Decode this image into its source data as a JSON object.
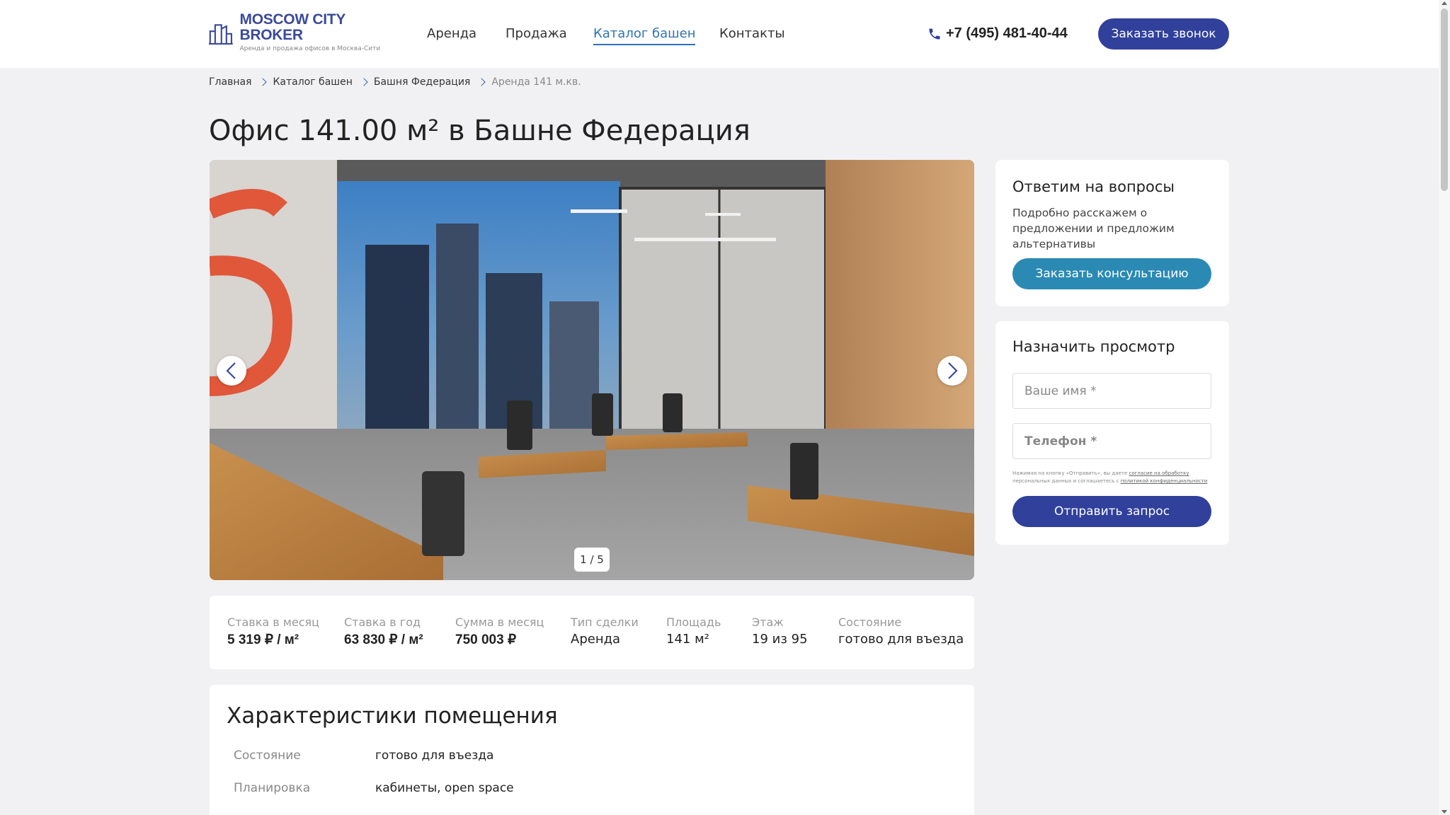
{
  "logo": {
    "title": "MOSCOW CITY BROKER",
    "subtitle": "Аренда и продажа офисов в Москва-Сити",
    "icon": "city-towers-logo"
  },
  "nav": {
    "items": [
      {
        "label": "Аренда",
        "active": false
      },
      {
        "label": "Продажа",
        "active": false
      },
      {
        "label": "Каталог башен",
        "active": true
      },
      {
        "label": "Контакты",
        "active": false
      }
    ]
  },
  "header": {
    "phone": "+7 (495) 481-40-44",
    "phone_icon": "phone-icon",
    "call_button": "Заказать звонок"
  },
  "breadcrumb": {
    "items": [
      "Главная",
      "Каталог башен",
      "Башня Федерация"
    ],
    "current": "Аренда 141 м.кв."
  },
  "page": {
    "title": "Офис 141.00 м² в Башне Федерация"
  },
  "gallery": {
    "counter": "1 / 5",
    "prev_icon": "chevron-left-icon",
    "next_icon": "chevron-right-icon"
  },
  "stats": [
    {
      "label": "Ставка в месяц",
      "value": "5 319 ₽ / м²",
      "bold": true
    },
    {
      "label": "Ставка в год",
      "value": "63 830 ₽ / м²",
      "bold": true
    },
    {
      "label": "Сумма в месяц",
      "value": "750 003 ₽",
      "bold": true
    },
    {
      "label": "Тип сделки",
      "value": "Аренда",
      "bold": false
    },
    {
      "label": "Площадь",
      "value": "141 м²",
      "bold": false
    },
    {
      "label": "Этаж",
      "value": "19 из 95",
      "bold": false
    },
    {
      "label": "Состояние",
      "value": "готово для въезда",
      "bold": false
    }
  ],
  "characteristics": {
    "title": "Характеристики помещения",
    "rows": [
      {
        "key": "Состояние",
        "value": "готово для въезда"
      },
      {
        "key": "Планировка",
        "value": "кабинеты, open space"
      }
    ]
  },
  "consult_card": {
    "title": "Ответим на вопросы",
    "text": "Подробно расскажем о предложении и предложим альтернативы",
    "button": "Заказать консультацию"
  },
  "viewing_card": {
    "title": "Назначить просмотр",
    "name_placeholder": "Ваше имя *",
    "phone_placeholder": "Телефон *",
    "consent_text": "Нажимая на кнопку «Отправить», вы даете",
    "consent_link1": "согласие на обработку",
    "consent_text2": "персональных данных и соглашаетесь c",
    "consent_link2": "политикой конфиденциальности",
    "button": "Отправить запрос"
  },
  "colors": {
    "primary": "#30409b",
    "teal": "#2a8ab3",
    "link": "#2f73b8",
    "background": "#f1f1f3"
  }
}
